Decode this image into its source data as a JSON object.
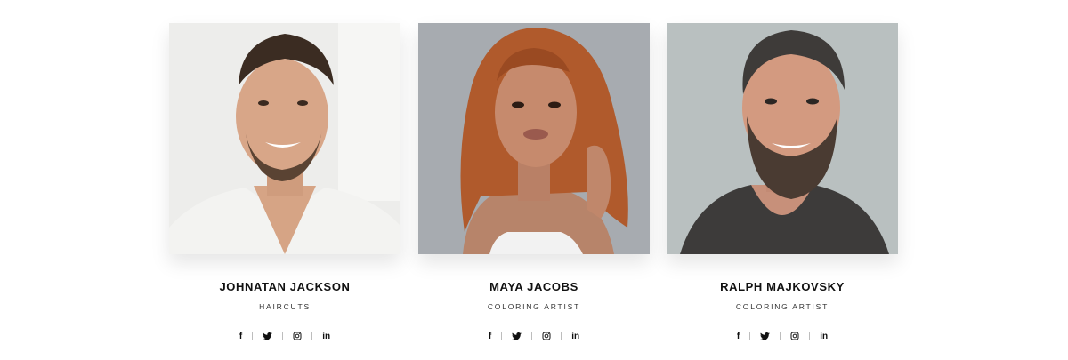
{
  "team": {
    "members": [
      {
        "name": "JOHNATAN JACKSON",
        "role": "HAIRCUTS",
        "photo_icon": "portrait-man-white-shirt",
        "social": [
          "facebook-icon",
          "twitter-icon",
          "instagram-icon",
          "linkedin-icon"
        ]
      },
      {
        "name": "MAYA JACOBS",
        "role": "COLORING ARTIST",
        "photo_icon": "portrait-woman-red-hair",
        "social": [
          "facebook-icon",
          "twitter-icon",
          "instagram-icon",
          "linkedin-icon"
        ]
      },
      {
        "name": "RALPH MAJKOVSKY",
        "role": "COLORING ARTIST",
        "photo_icon": "portrait-man-beard",
        "social": [
          "facebook-icon",
          "twitter-icon",
          "instagram-icon",
          "linkedin-icon"
        ]
      }
    ],
    "social_glyphs": {
      "facebook": "f",
      "linkedin": "in"
    },
    "colors": {
      "text": "#111111",
      "separator": "#bdbdbd",
      "photo1_bg": "#ededeb",
      "photo2_bg": "#a7abb0",
      "photo3_bg": "#b9c0c0"
    }
  }
}
